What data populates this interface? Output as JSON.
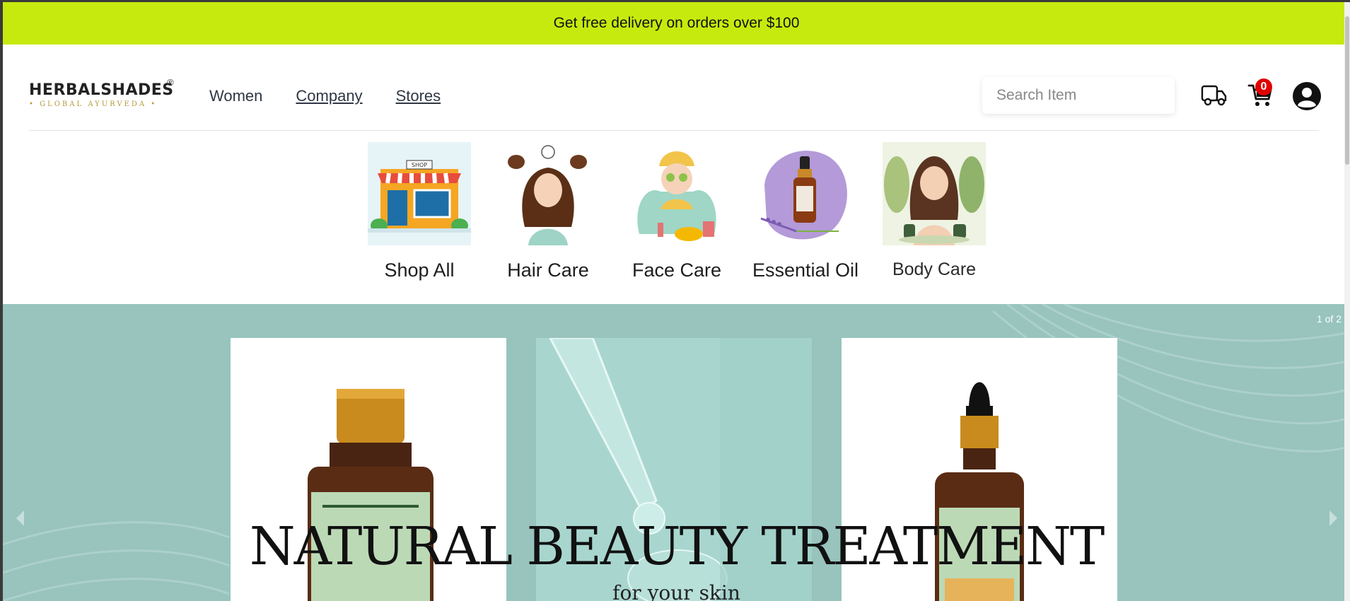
{
  "promo": {
    "text": "Get free delivery on orders over $100"
  },
  "brand": {
    "name": "HERBALSHADES",
    "registered": "®",
    "tagline": "• GLOBAL AYURVEDA •"
  },
  "nav": {
    "items": [
      {
        "label": "Women"
      },
      {
        "label": "Company"
      },
      {
        "label": "Stores"
      }
    ]
  },
  "search": {
    "placeholder": "Search Item"
  },
  "header_icons": {
    "truck": "truck-icon",
    "cart": "cart-icon",
    "account": "user-icon",
    "cart_count": "0"
  },
  "categories": [
    {
      "label": "Shop All",
      "icon": "shop-storefront-image"
    },
    {
      "label": "Hair Care",
      "icon": "hair-care-image"
    },
    {
      "label": "Face Care",
      "icon": "face-care-image"
    },
    {
      "label": "Essential Oil",
      "icon": "essential-oil-image"
    },
    {
      "label": "Body Care",
      "icon": "body-care-image"
    }
  ],
  "hero": {
    "counter": "1 of 2",
    "headline": "NATURAL BEAUTY TREATMENT",
    "subline": "for your skin",
    "background": "#98c4bd"
  },
  "colors": {
    "promo_bg": "#c7ea0e",
    "badge": "#e00000"
  }
}
